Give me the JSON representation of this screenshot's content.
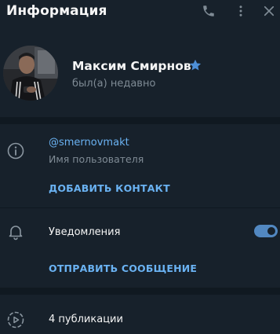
{
  "header": {
    "title": "Информация",
    "icons": [
      "phone-icon",
      "more-vertical-icon",
      "close-icon"
    ]
  },
  "profile": {
    "name": "Максим Смирнов",
    "status": "был(а) недавно",
    "badge_icon": "star-icon",
    "badge_color": "#4d8fd7"
  },
  "info": {
    "username": "@smernovmakt",
    "username_label": "Имя пользователя",
    "add_contact_label": "ДОБАВИТЬ КОНТАКТ"
  },
  "notifications": {
    "label": "Уведомления",
    "enabled": true,
    "send_message_label": "ОТПРАВИТЬ СООБЩЕНИЕ"
  },
  "posts": {
    "label": "4 публикации"
  },
  "colors": {
    "background": "#17212b",
    "divider": "#101921",
    "accent": "#6ab2f2",
    "toggle": "#5288c1",
    "secondary_text": "#7f8b95"
  }
}
